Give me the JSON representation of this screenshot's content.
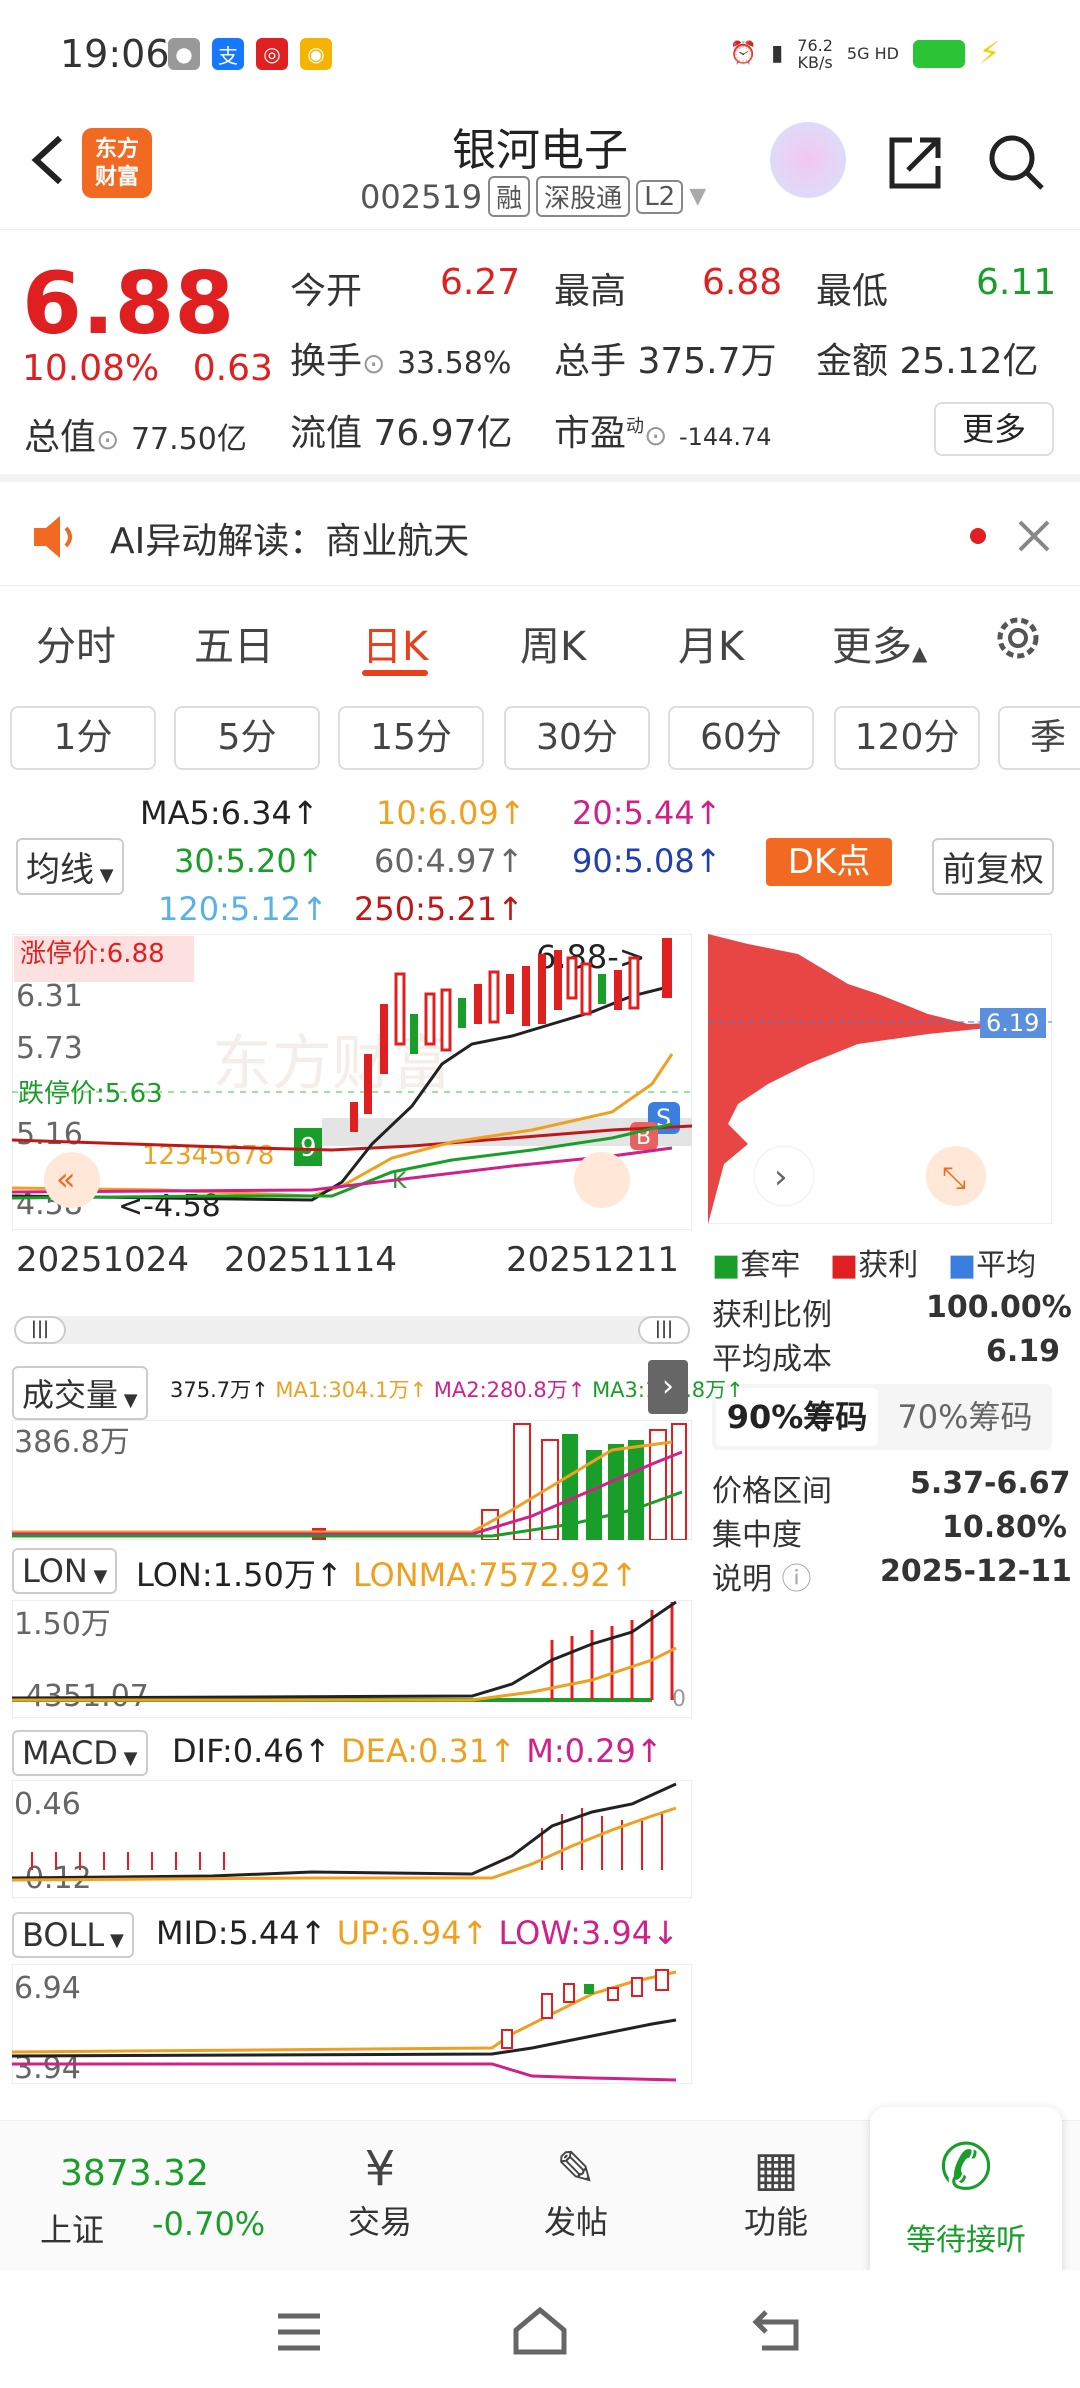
{
  "status": {
    "time": "19:06",
    "net_speed": "76.2\nKB/s",
    "net_type": "5G HD"
  },
  "header": {
    "title": "银河电子",
    "code": "002519",
    "tags": [
      "融",
      "深股通",
      "L2"
    ],
    "logo_text": "东方\n财富"
  },
  "quote": {
    "price": "6.88",
    "change_pct": "10.08%",
    "change_abs": "0.63",
    "open_label": "今开",
    "open": "6.27",
    "high_label": "最高",
    "high": "6.88",
    "low_label": "最低",
    "low": "6.11",
    "turnover_label": "换手",
    "turnover": "33.58%",
    "volume_label": "总手",
    "volume": "375.7万",
    "amount_label": "金额",
    "amount": "25.12亿",
    "total_cap_label": "总值",
    "total_cap": "77.50亿",
    "float_cap_label": "流值",
    "float_cap": "76.97亿",
    "pe_label": "市盈",
    "pe_sup": "动",
    "pe": "-144.74",
    "more": "更多"
  },
  "ai": {
    "label": "AI异动解读：商业航天"
  },
  "tabs": [
    "分时",
    "五日",
    "日K",
    "周K",
    "月K",
    "更多"
  ],
  "periods": [
    "1分",
    "5分",
    "15分",
    "30分",
    "60分",
    "120分",
    "季"
  ],
  "ma_legend": {
    "ma5": "MA5:6.34↑",
    "ma10": "10:6.09↑",
    "ma20": "20:5.44↑",
    "ma30": "30:5.20↑",
    "ma60": "60:4.97↑",
    "ma90": "90:5.08↑",
    "ma120": "120:5.12↑",
    "ma250": "250:5.21↑",
    "junxian": "均线",
    "dk": "DK点",
    "fuquan": "前复权"
  },
  "kline": {
    "zhangting": "涨停价:6.88",
    "dieting": "跌停价:5.63",
    "y_labels": [
      "6.31",
      "5.73",
      "5.16",
      "4.58"
    ],
    "max_label": "6.88->",
    "min_label": "<-4.58",
    "dates": [
      "20251024",
      "20251114",
      "20251211"
    ],
    "watermark": "东方财富",
    "nine": "9",
    "seq": "12345678",
    "s_badge": "S",
    "b_badge": "B",
    "k_mark": "K"
  },
  "chips": {
    "price_label": "6.19",
    "legend": [
      "套牢",
      "获利",
      "平均"
    ],
    "profit_ratio_label": "获利比例",
    "profit_ratio": "100.00%",
    "avg_cost_label": "平均成本",
    "avg_cost": "6.19",
    "tab90": "90%筹码",
    "tab70": "70%筹码",
    "range_label": "价格区间",
    "range": "5.37-6.67",
    "concentration_label": "集中度",
    "concentration": "10.80%",
    "note_label": "说明",
    "note_date": "2025-12-11"
  },
  "volume": {
    "selector": "成交量",
    "legend": "375.7万↑",
    "ma1": "MA1:304.1万↑",
    "ma2": "MA2:280.8万↑",
    "ma3": "MA3:155.8万↑",
    "y_label": "386.8万"
  },
  "lon": {
    "selector": "LON",
    "lon": "LON:1.50万↑",
    "lonma": "LONMA:7572.92↑",
    "y_top": "1.50万",
    "y_bottom": "-4351.07",
    "zero": "0"
  },
  "macd": {
    "selector": "MACD",
    "dif": "DIF:0.46↑",
    "dea": "DEA:0.31↑",
    "m": "M:0.29↑",
    "y_top": "0.46",
    "y_bottom": "-0.12"
  },
  "boll": {
    "selector": "BOLL",
    "mid": "MID:5.44↑",
    "up": "UP:6.94↑",
    "low": "LOW:3.94↓",
    "y_top": "6.94",
    "y_bottom": "3.94"
  },
  "bottom_nav": {
    "index_value": "3873.32",
    "index_name": "上证",
    "index_change": "-0.70%",
    "trade": "交易",
    "post": "发帖",
    "func": "功能",
    "waiting": "等待接听"
  },
  "colors": {
    "up": "#e02020",
    "down": "#1a9e2a",
    "accent": "#e8401c"
  }
}
